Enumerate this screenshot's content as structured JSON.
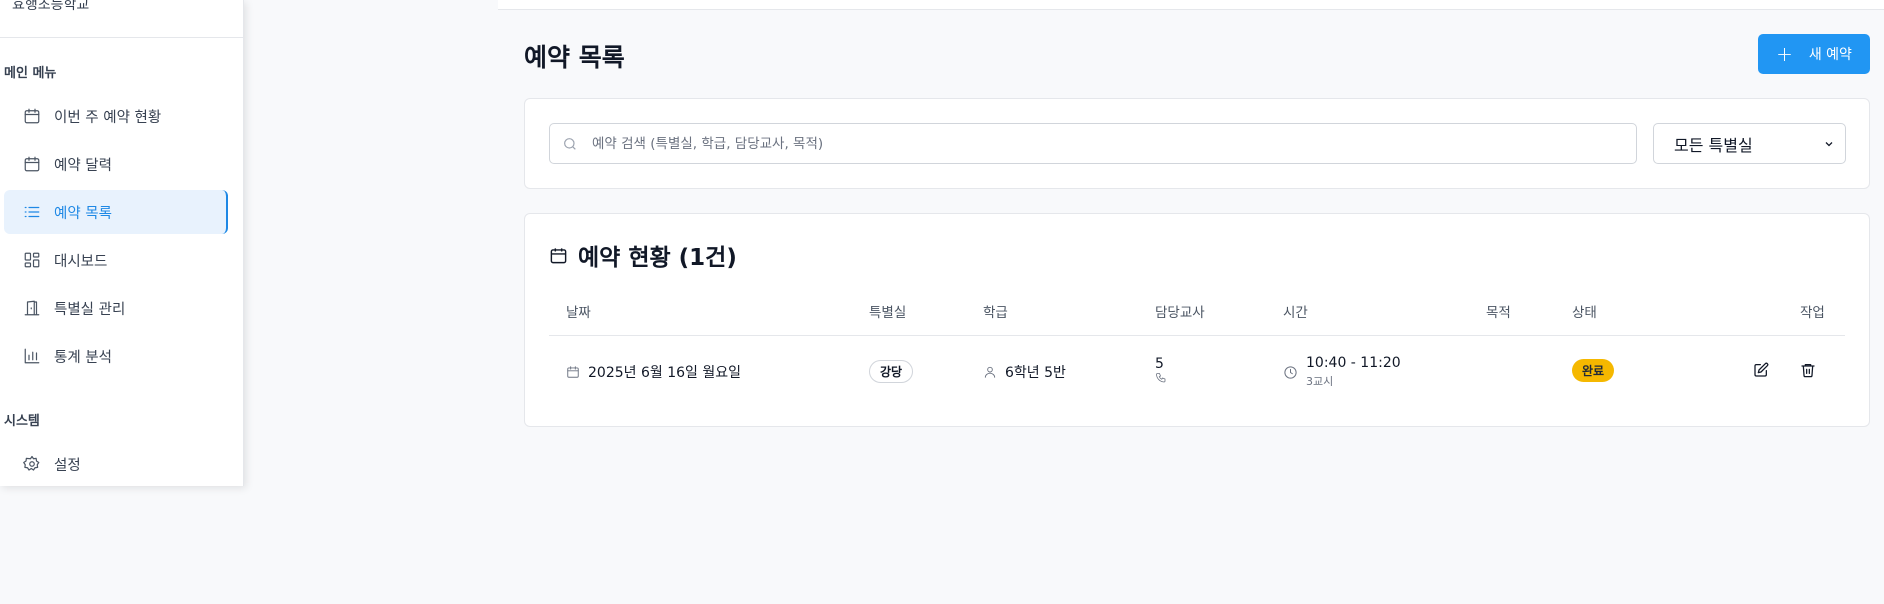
{
  "sidebar": {
    "school_name": "효행초등학교",
    "main_section": "메인 메뉴",
    "system_section": "시스템",
    "items": [
      {
        "label": "이번 주 예약 현황",
        "icon": "calendar-icon"
      },
      {
        "label": "예약 달력",
        "icon": "calendar-icon"
      },
      {
        "label": "예약 목록",
        "icon": "list-icon",
        "active": true
      },
      {
        "label": "대시보드",
        "icon": "dashboard-icon"
      },
      {
        "label": "특별실 관리",
        "icon": "door-icon"
      },
      {
        "label": "통계 분석",
        "icon": "bar-chart-icon"
      }
    ],
    "settings_label": "설정"
  },
  "page": {
    "title": "예약 목록",
    "new_button": "새 예약"
  },
  "filter": {
    "search_placeholder": "예약 검색 (특별실, 학급, 담당교사, 목적)",
    "room_select": "모든 특별실"
  },
  "list": {
    "title": "예약 현황 (1건)",
    "headers": {
      "date": "날짜",
      "room": "특별실",
      "class": "학급",
      "teacher": "담당교사",
      "time": "시간",
      "purpose": "목적",
      "status": "상태",
      "actions": "작업"
    },
    "rows": [
      {
        "date": "2025년 6월 16일 월요일",
        "room": "강당",
        "class": "6학년 5반",
        "teacher": "5",
        "time": "10:40 - 11:20",
        "period": "3교시",
        "purpose": "",
        "status": "완료"
      }
    ]
  },
  "colors": {
    "accent": "#2196f3",
    "status_done": "#f5b800",
    "active_bg": "#e8f2fd"
  }
}
